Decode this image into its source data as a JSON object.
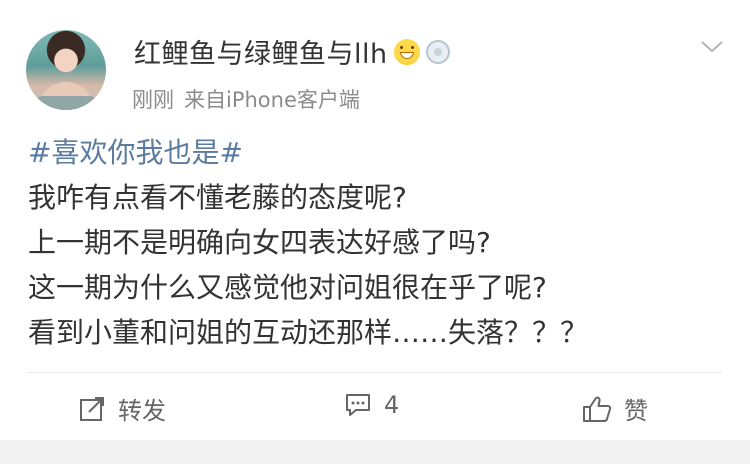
{
  "post": {
    "username": "红鲤鱼与绿鲤鱼与llh",
    "time": "刚刚",
    "source": "来自iPhone客户端",
    "hashtag": "#喜欢你我也是#",
    "lines": [
      "我咋有点看不懂老藤的态度呢?",
      "上一期不是明确向女四表达好感了吗?",
      "这一期为什么又感觉他对问姐很在乎了呢?",
      "看到小董和问姐的互动还那样……失落？？？"
    ]
  },
  "actions": {
    "repost_label": "转发",
    "comment_count": "4",
    "like_label": "赞"
  },
  "icons": {
    "emoji": "grin-emoji-icon",
    "badge": "medal-badge-icon",
    "menu": "chevron-down-icon",
    "repost": "share-icon",
    "comment": "comment-icon",
    "like": "thumbs-up-icon"
  },
  "colors": {
    "hashtag": "#5b7ca0",
    "text": "#333333",
    "meta": "#8b8b8b"
  }
}
